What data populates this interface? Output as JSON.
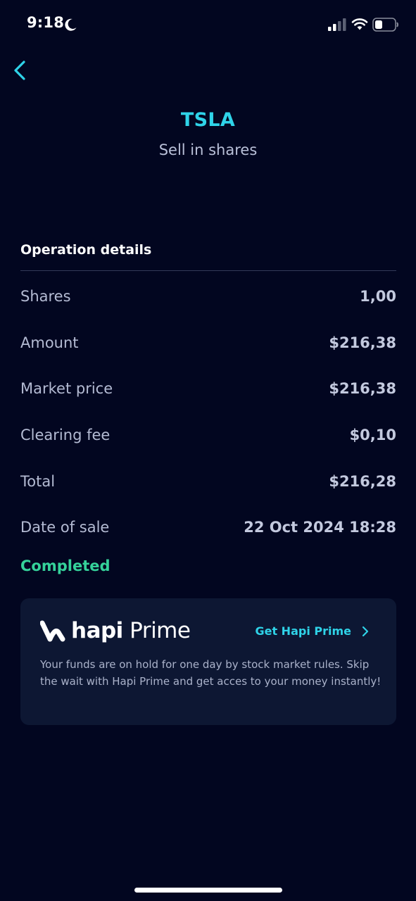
{
  "status_bar": {
    "time": "9:18",
    "icons": [
      "moon-icon",
      "signal-icon",
      "wifi-icon",
      "battery-icon"
    ]
  },
  "header": {
    "ticker": "TSLA",
    "subtitle": "Sell in shares"
  },
  "details": {
    "title": "Operation details",
    "rows": [
      {
        "label": "Shares",
        "value": "1,00"
      },
      {
        "label": "Amount",
        "value": "$216,38"
      },
      {
        "label": "Market price",
        "value": "$216,38"
      },
      {
        "label": "Clearing fee",
        "value": "$0,10"
      },
      {
        "label": "Total",
        "value": "$216,28"
      },
      {
        "label": "Date of sale",
        "value": "22 Oct 2024 18:28"
      }
    ],
    "status": "Completed"
  },
  "promo": {
    "brand_bold": "hapi",
    "brand_light": "Prime",
    "cta": "Get Hapi Prime",
    "text": "Your funds are on hold for one day by stock market rules. Skip the wait with Hapi Prime and get acces to your money instantly!"
  },
  "colors": {
    "background": "#020620",
    "accent": "#2fd3e8",
    "success": "#35d29a",
    "card": "#0d1733"
  }
}
